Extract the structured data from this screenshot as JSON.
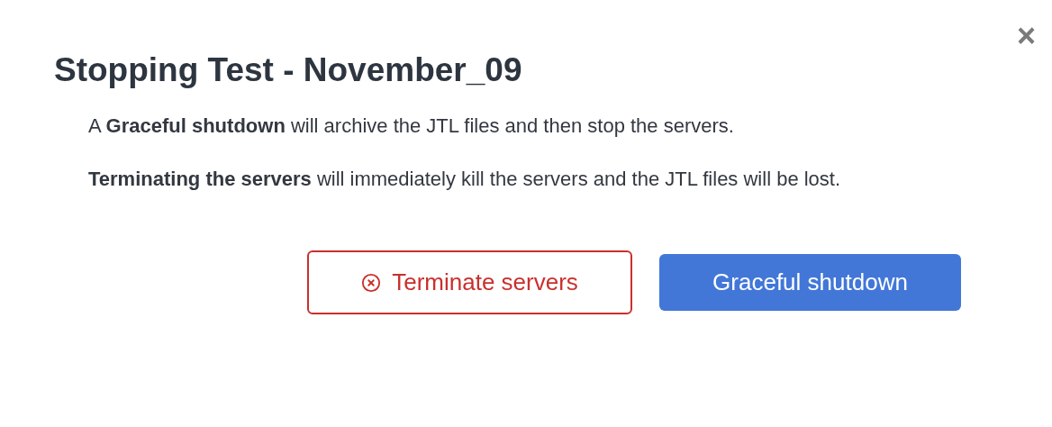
{
  "dialog": {
    "title": "Stopping Test - November_09",
    "close": "×",
    "paragraphs": [
      "A **Graceful shutdown** will archive the JTL files and then stop the servers.",
      "**Terminating the servers** will immediately kill the servers and the JTL files will be lost."
    ],
    "buttons": [
      {
        "kind": "danger",
        "label": "Terminate servers"
      },
      {
        "kind": "primary",
        "label": "Graceful shutdown"
      }
    ]
  }
}
